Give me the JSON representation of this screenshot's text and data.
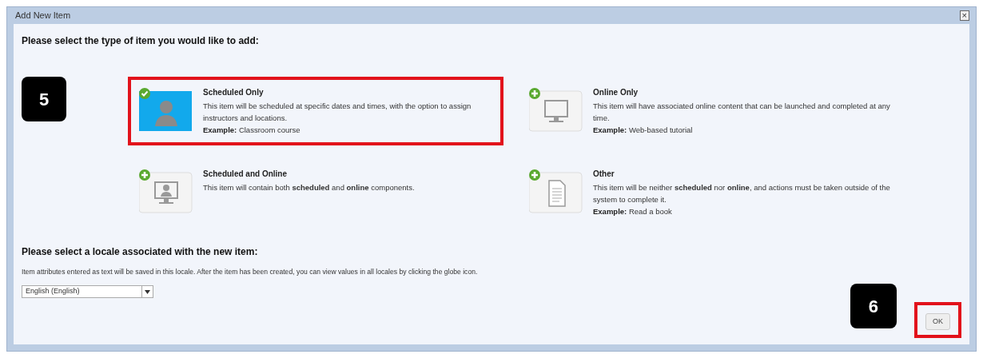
{
  "window": {
    "title": "Add New Item",
    "close": "×"
  },
  "type_heading": "Please select the type of item you would like to add:",
  "callouts": [
    "5",
    "6"
  ],
  "item_types": [
    {
      "kind": "person",
      "title": "Scheduled Only",
      "description": "This item will be scheduled at specific dates and times, with the option to assign instructors and locations.",
      "example_label": "Example:",
      "example": "Classroom course",
      "selected": true
    },
    {
      "kind": "monitor",
      "title": "Online Only",
      "description": "This item will have associated online content that can be launched and completed at any time.",
      "example_label": "Example:",
      "example": "Web-based tutorial",
      "selected": false
    },
    {
      "kind": "monitor-person",
      "title": "Scheduled and Online",
      "description": "This item will contain both **scheduled** and **online** components.",
      "selected": false
    },
    {
      "kind": "document",
      "title": "Other",
      "description": "This item will be neither **scheduled** nor **online**, and actions must be taken outside of the system to complete it.",
      "example_label": "Example:",
      "example": "Read a book",
      "selected": false
    }
  ],
  "locale": {
    "heading": "Please select a locale associated with the new item:",
    "note": "Item attributes entered as text will be saved in this locale. After the item has been created, you can view values in all locales by clicking the globe icon.",
    "value": "English (English)"
  },
  "ok_button": {
    "label": "OK",
    "highlighted": true
  }
}
